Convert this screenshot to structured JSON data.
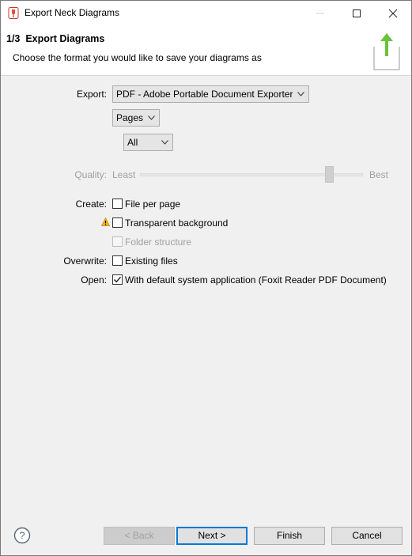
{
  "window": {
    "title": "Export Neck Diagrams"
  },
  "banner": {
    "step": "1/3",
    "title": "Export Diagrams",
    "description": "Choose the format you would like to save your diagrams as"
  },
  "form": {
    "export_label": "Export:",
    "export_value": "PDF - Adobe Portable Document Exporter",
    "scope_value": "Pages",
    "pages_value": "All",
    "quality_label": "Quality:",
    "quality_min": "Least",
    "quality_max": "Best",
    "quality_level": 0.85,
    "create_label": "Create:",
    "file_per_page": "File per page",
    "transparent_background": "Transparent background",
    "folder_structure": "Folder structure",
    "overwrite_label": "Overwrite:",
    "existing_files": "Existing files",
    "open_label": "Open:",
    "open_default": "With default system application (Foxit Reader PDF Document)"
  },
  "checks": {
    "file_per_page": false,
    "transparent_background": false,
    "folder_structure": false,
    "existing_files": false,
    "open_default": true
  },
  "buttons": {
    "back": "< Back",
    "next": "Next >",
    "finish": "Finish",
    "cancel": "Cancel"
  },
  "colors": {
    "accent": "#0078d7",
    "export_arrow": "#6ac33a",
    "warning": "#f2b61c"
  }
}
